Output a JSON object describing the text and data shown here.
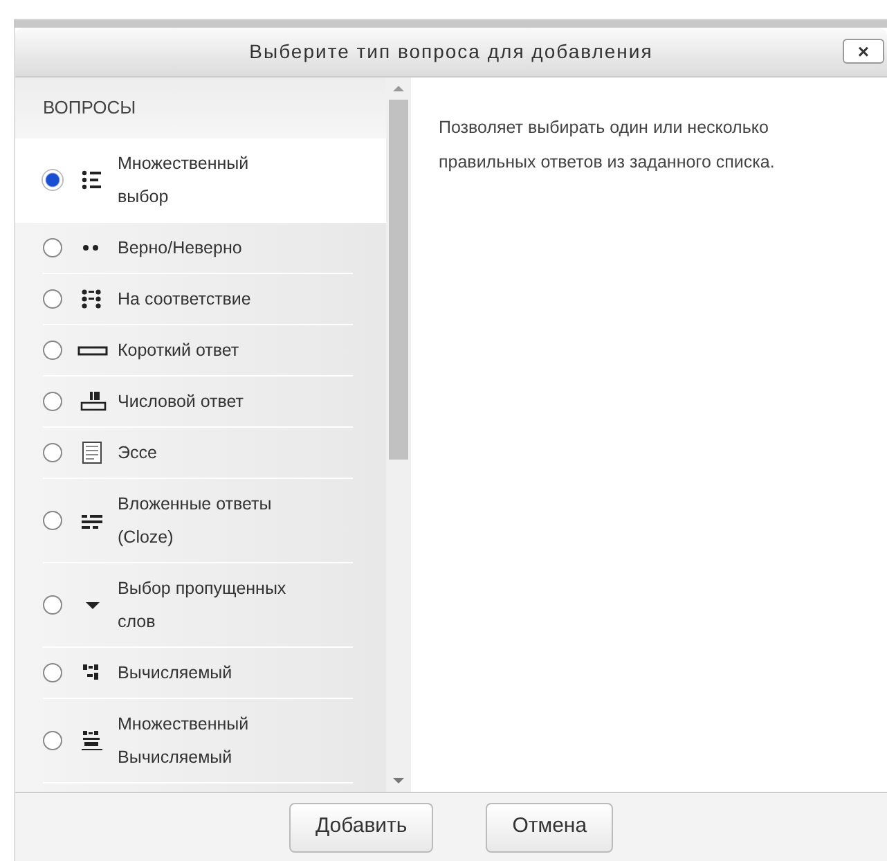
{
  "dialog": {
    "title": "Выберите тип вопроса для добавления",
    "close": "×"
  },
  "section_heading": "ВОПРОСЫ",
  "question_types": [
    {
      "label": "Множественный выбор",
      "kind": "multichoice",
      "selected": true
    },
    {
      "label": "Верно/Неверно",
      "kind": "truefalse",
      "selected": false
    },
    {
      "label": "На соответствие",
      "kind": "match",
      "selected": false
    },
    {
      "label": "Короткий ответ",
      "kind": "shortanswer",
      "selected": false
    },
    {
      "label": "Числовой ответ",
      "kind": "numerical",
      "selected": false
    },
    {
      "label": "Эссе",
      "kind": "essay",
      "selected": false
    },
    {
      "label": "Вложенные ответы (Cloze)",
      "kind": "cloze",
      "selected": false
    },
    {
      "label": "Выбор пропущенных слов",
      "kind": "dropdown",
      "selected": false
    },
    {
      "label": "Вычисляемый",
      "kind": "calculated",
      "selected": false
    },
    {
      "label": "Множественный Вычисляемый",
      "kind": "calcmulti",
      "selected": false
    }
  ],
  "description": "Позволяет выбирать один или несколько правильных ответов из заданного списка.",
  "buttons": [
    "Добавить",
    "Отмена"
  ]
}
